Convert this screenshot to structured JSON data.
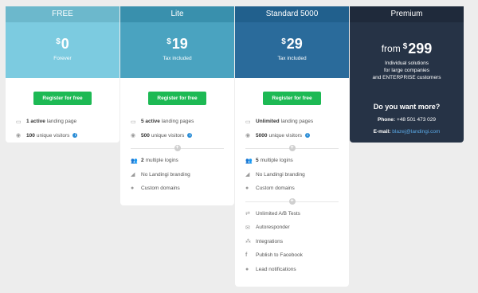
{
  "plans": [
    {
      "name": "FREE",
      "currency": "$",
      "price": "0",
      "subtitle": "Forever",
      "button": "Register for free",
      "colors": {
        "title_bg": "#6cb8cc",
        "hero_bg": "#7ccbe0"
      },
      "features": [
        {
          "icon": "monitor-icon",
          "bold": "1 active",
          "text": "landing page"
        },
        {
          "icon": "eye-icon",
          "bold": "100",
          "text": "unique visitors",
          "info": "i"
        }
      ],
      "groups": []
    },
    {
      "name": "Lite",
      "currency": "$",
      "price": "19",
      "subtitle": "Tax included",
      "button": "Register for free",
      "colors": {
        "title_bg": "#3990ad",
        "hero_bg": "#4aa3c0"
      },
      "features": [
        {
          "icon": "monitor-icon",
          "bold": "5 active",
          "text": "landing pages"
        },
        {
          "icon": "eye-icon",
          "bold": "500",
          "text": "unique visitors",
          "info": "i"
        }
      ],
      "groups": [
        [
          {
            "icon": "users-icon",
            "bold": "2",
            "text": "multiple logins"
          },
          {
            "icon": "signal-icon",
            "bold": "",
            "text": "No Landingi branding"
          },
          {
            "icon": "globe-icon",
            "bold": "",
            "text": "Custom domains"
          }
        ]
      ]
    },
    {
      "name": "Standard 5000",
      "currency": "$",
      "price": "29",
      "subtitle": "Tax included",
      "button": "Register for free",
      "colors": {
        "title_bg": "#21608d",
        "hero_bg": "#2a6b9b"
      },
      "features": [
        {
          "icon": "monitor-icon",
          "bold": "Unlimited",
          "text": "landing pages"
        },
        {
          "icon": "eye-icon",
          "bold": "5000",
          "text": "unique visitors",
          "info": "i"
        }
      ],
      "groups": [
        [
          {
            "icon": "users-icon",
            "bold": "5",
            "text": "multiple logins"
          },
          {
            "icon": "signal-icon",
            "bold": "",
            "text": "No Landingi branding"
          },
          {
            "icon": "globe-icon",
            "bold": "",
            "text": "Custom domains"
          }
        ],
        [
          {
            "icon": "shuffle-icon",
            "bold": "",
            "text": "Unlimited A/B Tests"
          },
          {
            "icon": "envelope-icon",
            "bold": "",
            "text": "Autoresponder"
          },
          {
            "icon": "integrations-icon",
            "bold": "",
            "text": "Integrations"
          },
          {
            "icon": "facebook-icon",
            "bold": "",
            "text": "Publish to Facebook"
          },
          {
            "icon": "info-circle-icon",
            "bold": "",
            "text": "Lead notifications"
          }
        ]
      ]
    }
  ],
  "premium": {
    "name": "Premium",
    "from": "from",
    "currency": "$",
    "price": "299",
    "desc_line1": "Individual solutions",
    "desc_line2": "for large companies",
    "desc_line3": "and ENTERPRISE customers",
    "more": "Do you want more?",
    "phone_label": "Phone:",
    "phone": "+48 501 473 029",
    "email_label": "E-mail:",
    "email": "blazej@landingi.com",
    "colors": {
      "bg": "#263346",
      "link": "#5aa9e6"
    }
  },
  "colors": {
    "button": "#1db954",
    "info": "#2b8dd6",
    "page_bg": "#ededed"
  }
}
